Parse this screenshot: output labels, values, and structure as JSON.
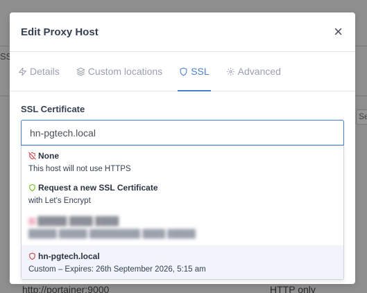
{
  "background": {
    "left_fragment": "SS",
    "right_fragment": "Se",
    "row_url": "http://portainer:9000",
    "row_ssl": "HTTP only"
  },
  "modal": {
    "title": "Edit Proxy Host",
    "close_symbol": "×"
  },
  "tabs": [
    {
      "label": "Details",
      "icon": "zap-icon"
    },
    {
      "label": "Custom locations",
      "icon": "layers-icon"
    },
    {
      "label": "SSL",
      "icon": "shield-icon",
      "active": true
    },
    {
      "label": "Advanced",
      "icon": "gear-icon"
    }
  ],
  "ssl_certificate": {
    "label": "SSL Certificate",
    "selected_value": "hn-pgtech.local",
    "options": [
      {
        "title": "None",
        "subtitle": "This host will not use HTTPS",
        "icon": "shield-off-icon",
        "color": "#cd201f"
      },
      {
        "title": "Request a new SSL Certificate",
        "subtitle": "with Let's Encrypt",
        "icon": "shield-icon",
        "color": "#5eba00"
      },
      {
        "title": "█████ ████ ████",
        "subtitle": "█████ █████ █████████ ████ █████",
        "icon": "shield-icon",
        "color": "#f2b8c6"
      },
      {
        "title": "hn-pgtech.local",
        "subtitle": "Custom – Expires: 26th September 2026, 5:15 am",
        "icon": "shield-icon",
        "color": "#cd201f"
      }
    ]
  },
  "colors": {
    "accent": "#467fcf",
    "muted_tab": "#9aa0ac"
  }
}
